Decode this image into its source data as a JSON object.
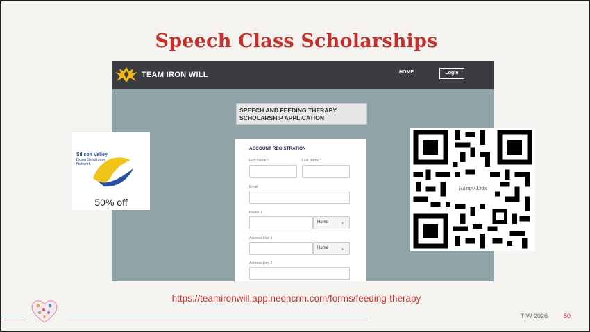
{
  "slide": {
    "title": "Speech Class Scholarships",
    "url": "https://teamironwill.app.neoncrm.com/forms/feeding-therapy",
    "footer_text": "TIW 2026",
    "page_number": "50",
    "accent_color": "#c2312e"
  },
  "website": {
    "brand": "TEAM IRON WILL",
    "nav_home": "HOME",
    "nav_login": "Login",
    "header_line1": "SPEECH AND FEEDING THERAPY",
    "header_line2": "SCHOLARSHIP APPLICATION",
    "form": {
      "section_title": "ACCOUNT REGISTRATION",
      "first_name_label": "First Name *",
      "last_name_label": "Last Name *",
      "email_label": "Email",
      "phone_label": "Phone 1",
      "phone_type": "Home",
      "address1_label": "Address Line 1",
      "address1_type": "Home",
      "address2_label": "Address Line 2"
    }
  },
  "badge": {
    "org_line1": "Silicon Valley",
    "org_line2": "Down Syndrome",
    "org_line3": "Network",
    "discount": "50% off"
  },
  "qr": {
    "center_logo_text": "Happy Kids",
    "icon": "qr-code-icon"
  }
}
